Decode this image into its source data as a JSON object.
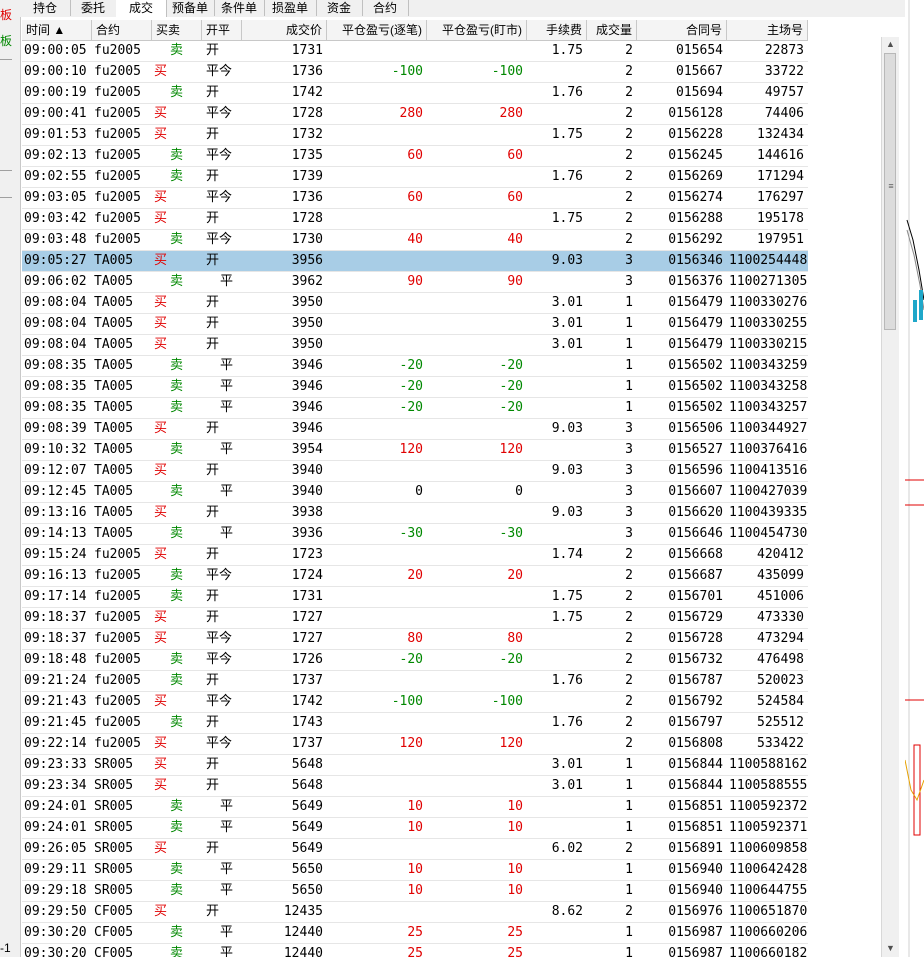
{
  "left_strip": {
    "label1": "板",
    "label2": "板",
    "label3": "-1"
  },
  "tabs": [
    {
      "label": "持仓",
      "active": false
    },
    {
      "label": "委托",
      "active": false
    },
    {
      "label": "成交",
      "active": true
    },
    {
      "label": "预备单",
      "active": false
    },
    {
      "label": "条件单",
      "active": false
    },
    {
      "label": "损盈单",
      "active": false
    },
    {
      "label": "资金",
      "active": false
    },
    {
      "label": "合约",
      "active": false
    }
  ],
  "columns": [
    "时间 ▲",
    "合约",
    "买卖",
    "开平",
    "成交价",
    "平仓盈亏(逐笔)",
    "平仓盈亏(盯市)",
    "手续费",
    "成交量",
    "合同号",
    "主场号"
  ],
  "rows": [
    [
      "09:00:05",
      "fu2005",
      "卖",
      "开",
      "1731",
      "",
      "",
      "1.75",
      "2",
      "015654",
      "22873"
    ],
    [
      "09:00:10",
      "fu2005",
      "买",
      "平今",
      "1736",
      "-100",
      "-100",
      "",
      "2",
      "015667",
      "33722"
    ],
    [
      "09:00:19",
      "fu2005",
      "卖",
      "开",
      "1742",
      "",
      "",
      "1.76",
      "2",
      "015694",
      "49757"
    ],
    [
      "09:00:41",
      "fu2005",
      "买",
      "平今",
      "1728",
      "280",
      "280",
      "",
      "2",
      "0156128",
      "74406"
    ],
    [
      "09:01:53",
      "fu2005",
      "买",
      "开",
      "1732",
      "",
      "",
      "1.75",
      "2",
      "0156228",
      "132434"
    ],
    [
      "09:02:13",
      "fu2005",
      "卖",
      "平今",
      "1735",
      "60",
      "60",
      "",
      "2",
      "0156245",
      "144616"
    ],
    [
      "09:02:55",
      "fu2005",
      "卖",
      "开",
      "1739",
      "",
      "",
      "1.76",
      "2",
      "0156269",
      "171294"
    ],
    [
      "09:03:05",
      "fu2005",
      "买",
      "平今",
      "1736",
      "60",
      "60",
      "",
      "2",
      "0156274",
      "176297"
    ],
    [
      "09:03:42",
      "fu2005",
      "买",
      "开",
      "1728",
      "",
      "",
      "1.75",
      "2",
      "0156288",
      "195178"
    ],
    [
      "09:03:48",
      "fu2005",
      "卖",
      "平今",
      "1730",
      "40",
      "40",
      "",
      "2",
      "0156292",
      "197951"
    ],
    [
      "09:05:27",
      "TA005",
      "买",
      "开",
      "3956",
      "",
      "",
      "9.03",
      "3",
      "0156346",
      "1100254448"
    ],
    [
      "09:06:02",
      "TA005",
      "卖",
      "平",
      "3962",
      "90",
      "90",
      "",
      "3",
      "0156376",
      "1100271305"
    ],
    [
      "09:08:04",
      "TA005",
      "买",
      "开",
      "3950",
      "",
      "",
      "3.01",
      "1",
      "0156479",
      "1100330276"
    ],
    [
      "09:08:04",
      "TA005",
      "买",
      "开",
      "3950",
      "",
      "",
      "3.01",
      "1",
      "0156479",
      "1100330255"
    ],
    [
      "09:08:04",
      "TA005",
      "买",
      "开",
      "3950",
      "",
      "",
      "3.01",
      "1",
      "0156479",
      "1100330215"
    ],
    [
      "09:08:35",
      "TA005",
      "卖",
      "平",
      "3946",
      "-20",
      "-20",
      "",
      "1",
      "0156502",
      "1100343259"
    ],
    [
      "09:08:35",
      "TA005",
      "卖",
      "平",
      "3946",
      "-20",
      "-20",
      "",
      "1",
      "0156502",
      "1100343258"
    ],
    [
      "09:08:35",
      "TA005",
      "卖",
      "平",
      "3946",
      "-20",
      "-20",
      "",
      "1",
      "0156502",
      "1100343257"
    ],
    [
      "09:08:39",
      "TA005",
      "买",
      "开",
      "3946",
      "",
      "",
      "9.03",
      "3",
      "0156506",
      "1100344927"
    ],
    [
      "09:10:32",
      "TA005",
      "卖",
      "平",
      "3954",
      "120",
      "120",
      "",
      "3",
      "0156527",
      "1100376416"
    ],
    [
      "09:12:07",
      "TA005",
      "买",
      "开",
      "3940",
      "",
      "",
      "9.03",
      "3",
      "0156596",
      "1100413516"
    ],
    [
      "09:12:45",
      "TA005",
      "卖",
      "平",
      "3940",
      "0",
      "0",
      "",
      "3",
      "0156607",
      "1100427039"
    ],
    [
      "09:13:16",
      "TA005",
      "买",
      "开",
      "3938",
      "",
      "",
      "9.03",
      "3",
      "0156620",
      "1100439335"
    ],
    [
      "09:14:13",
      "TA005",
      "卖",
      "平",
      "3936",
      "-30",
      "-30",
      "",
      "3",
      "0156646",
      "1100454730"
    ],
    [
      "09:15:24",
      "fu2005",
      "买",
      "开",
      "1723",
      "",
      "",
      "1.74",
      "2",
      "0156668",
      "420412"
    ],
    [
      "09:16:13",
      "fu2005",
      "卖",
      "平今",
      "1724",
      "20",
      "20",
      "",
      "2",
      "0156687",
      "435099"
    ],
    [
      "09:17:14",
      "fu2005",
      "卖",
      "开",
      "1731",
      "",
      "",
      "1.75",
      "2",
      "0156701",
      "451006"
    ],
    [
      "09:18:37",
      "fu2005",
      "买",
      "开",
      "1727",
      "",
      "",
      "1.75",
      "2",
      "0156729",
      "473330"
    ],
    [
      "09:18:37",
      "fu2005",
      "买",
      "平今",
      "1727",
      "80",
      "80",
      "",
      "2",
      "0156728",
      "473294"
    ],
    [
      "09:18:48",
      "fu2005",
      "卖",
      "平今",
      "1726",
      "-20",
      "-20",
      "",
      "2",
      "0156732",
      "476498"
    ],
    [
      "09:21:24",
      "fu2005",
      "卖",
      "开",
      "1737",
      "",
      "",
      "1.76",
      "2",
      "0156787",
      "520023"
    ],
    [
      "09:21:43",
      "fu2005",
      "买",
      "平今",
      "1742",
      "-100",
      "-100",
      "",
      "2",
      "0156792",
      "524584"
    ],
    [
      "09:21:45",
      "fu2005",
      "卖",
      "开",
      "1743",
      "",
      "",
      "1.76",
      "2",
      "0156797",
      "525512"
    ],
    [
      "09:22:14",
      "fu2005",
      "买",
      "平今",
      "1737",
      "120",
      "120",
      "",
      "2",
      "0156808",
      "533422"
    ],
    [
      "09:23:33",
      "SR005",
      "买",
      "开",
      "5648",
      "",
      "",
      "3.01",
      "1",
      "0156844",
      "1100588162"
    ],
    [
      "09:23:34",
      "SR005",
      "买",
      "开",
      "5648",
      "",
      "",
      "3.01",
      "1",
      "0156844",
      "1100588555"
    ],
    [
      "09:24:01",
      "SR005",
      "卖",
      "平",
      "5649",
      "10",
      "10",
      "",
      "1",
      "0156851",
      "1100592372"
    ],
    [
      "09:24:01",
      "SR005",
      "卖",
      "平",
      "5649",
      "10",
      "10",
      "",
      "1",
      "0156851",
      "1100592371"
    ],
    [
      "09:26:05",
      "SR005",
      "买",
      "开",
      "5649",
      "",
      "",
      "6.02",
      "2",
      "0156891",
      "1100609858"
    ],
    [
      "09:29:11",
      "SR005",
      "卖",
      "平",
      "5650",
      "10",
      "10",
      "",
      "1",
      "0156940",
      "1100642428"
    ],
    [
      "09:29:18",
      "SR005",
      "卖",
      "平",
      "5650",
      "10",
      "10",
      "",
      "1",
      "0156940",
      "1100644755"
    ],
    [
      "09:29:50",
      "CF005",
      "买",
      "开",
      "12435",
      "",
      "",
      "8.62",
      "2",
      "0156976",
      "1100651870"
    ],
    [
      "09:30:20",
      "CF005",
      "卖",
      "平",
      "12440",
      "25",
      "25",
      "",
      "1",
      "0156987",
      "1100660206"
    ],
    [
      "09:30:20",
      "CF005",
      "卖",
      "平",
      "12440",
      "25",
      "25",
      "",
      "1",
      "0156987",
      "1100660182"
    ]
  ],
  "selected_row": 10,
  "colors": {
    "buy": "#e00000",
    "sell": "#008800",
    "selected": "#a8cde6"
  }
}
